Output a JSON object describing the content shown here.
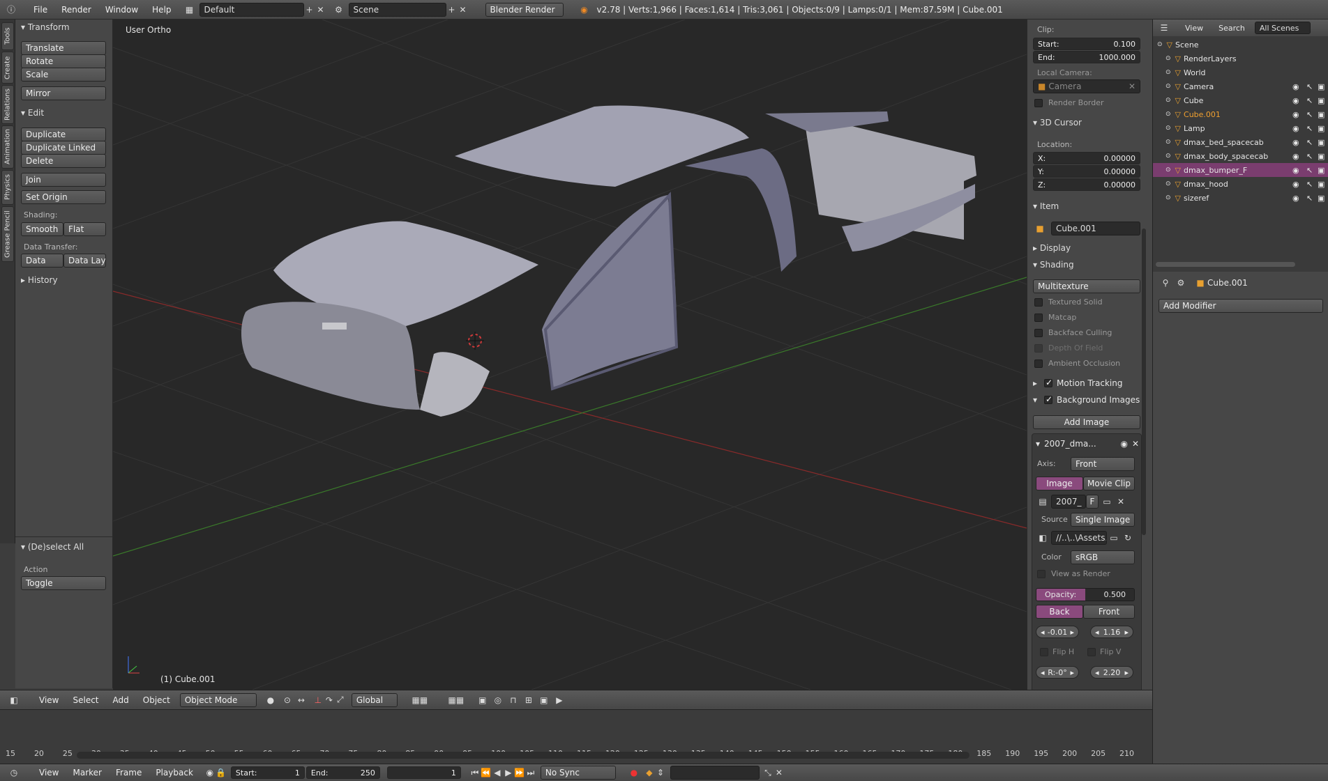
{
  "topbar": {
    "menus": [
      "File",
      "Render",
      "Window",
      "Help"
    ],
    "layout": "Default",
    "scene": "Scene",
    "engine": "Blender Render",
    "stats": "v2.78 | Verts:1,966 | Faces:1,614 | Tris:3,061 | Objects:0/9 | Lamps:0/1 | Mem:87.59M | Cube.001"
  },
  "vertical_tabs": [
    "Tools",
    "Create",
    "Relations",
    "Animation",
    "Physics",
    "Grease Pencil"
  ],
  "tools": {
    "transform_header": "Transform",
    "translate": "Translate",
    "rotate": "Rotate",
    "scale": "Scale",
    "mirror": "Mirror",
    "edit_header": "Edit",
    "duplicate": "Duplicate",
    "duplicate_linked": "Duplicate Linked",
    "delete": "Delete",
    "join": "Join",
    "set_origin": "Set Origin",
    "shading_label": "Shading:",
    "smooth": "Smooth",
    "flat": "Flat",
    "data_transfer_label": "Data Transfer:",
    "data": "Data",
    "data_layout": "Data Layo",
    "history_header": "History",
    "deselect_header": "(De)select All",
    "action_label": "Action",
    "action_value": "Toggle"
  },
  "viewport": {
    "view_name": "User Ortho",
    "object_label": "(1) Cube.001"
  },
  "properties": {
    "clip_label": "Clip:",
    "start_label": "Start:",
    "start_value": "0.100",
    "end_label": "End:",
    "end_value": "1000.000",
    "local_camera_label": "Local Camera:",
    "camera_placeholder": "Camera",
    "render_border": "Render Border",
    "cursor_header": "3D Cursor",
    "location_label": "Location:",
    "x_label": "X:",
    "x_value": "0.00000",
    "y_label": "Y:",
    "y_value": "0.00000",
    "z_label": "Z:",
    "z_value": "0.00000",
    "item_header": "Item",
    "item_name": "Cube.001",
    "display_header": "Display",
    "shading_header": "Shading",
    "shading_mode": "Multitexture",
    "textured_solid": "Textured Solid",
    "matcap": "Matcap",
    "backface_culling": "Backface Culling",
    "depth_of_field": "Depth Of Field",
    "ambient_occlusion": "Ambient Occlusion",
    "motion_tracking": "Motion Tracking",
    "background_images": "Background Images",
    "add_image": "Add Image",
    "bg_image_name": "2007_dma...",
    "axis_label": "Axis:",
    "axis_value": "Front",
    "tab_image": "Image",
    "tab_movie_clip": "Movie Clip",
    "image_field": "2007_",
    "image_f": "F",
    "source_label": "Source",
    "source_value": "Single Image",
    "path_value": "//..\\..\\Assets...",
    "color_label": "Color",
    "color_value": "sRGB",
    "view_as_render": "View as Render",
    "opacity_label": "Opacity:",
    "opacity_value": "0.500",
    "opacity_fraction": 0.5,
    "back": "Back",
    "front": "Front",
    "offset_x": "-0.01",
    "offset_y": "1.16",
    "flip_h": "Flip H",
    "flip_v": "Flip V",
    "rotation": "R:-0°",
    "size": "2.20"
  },
  "outliner": {
    "view": "View",
    "search": "Search",
    "filter": "All Scenes",
    "rows": [
      {
        "label": "Scene",
        "color": "#e6e6e6",
        "selected": false
      },
      {
        "label": "RenderLayers",
        "color": "#e6e6e6",
        "selected": false
      },
      {
        "label": "World",
        "color": "#e6e6e6",
        "selected": false
      },
      {
        "label": "Camera",
        "color": "#e6e6e6",
        "selected": false
      },
      {
        "label": "Cube",
        "color": "#e6e6e6",
        "selected": false
      },
      {
        "label": "Cube.001",
        "color": "#f0a030",
        "selected": false
      },
      {
        "label": "Lamp",
        "color": "#e6e6e6",
        "selected": false
      },
      {
        "label": "dmax_bed_spacecab",
        "color": "#e6e6e6",
        "selected": false
      },
      {
        "label": "dmax_body_spacecab",
        "color": "#e6e6e6",
        "selected": false
      },
      {
        "label": "dmax_bumper_F",
        "color": "#e6e6e6",
        "selected": true
      },
      {
        "label": "dmax_hood",
        "color": "#e6e6e6",
        "selected": false
      },
      {
        "label": "sizeref",
        "color": "#e6e6e6",
        "selected": false
      }
    ]
  },
  "modifiers": {
    "object": "Cube.001",
    "add_modifier": "Add Modifier"
  },
  "view_header": {
    "view": "View",
    "select": "Select",
    "add": "Add",
    "object": "Object",
    "mode": "Object Mode",
    "orientation": "Global"
  },
  "timeline": {
    "ticks": [
      "15",
      "20",
      "25",
      "30",
      "35",
      "40",
      "45",
      "50",
      "55",
      "60",
      "65",
      "70",
      "75",
      "80",
      "85",
      "90",
      "95",
      "100",
      "105",
      "110",
      "115",
      "120",
      "125",
      "130",
      "135",
      "140",
      "145",
      "150",
      "155",
      "160",
      "165",
      "170",
      "175",
      "180",
      "185",
      "190",
      "195",
      "200",
      "205",
      "210"
    ]
  },
  "timeline_header": {
    "view": "View",
    "marker": "Marker",
    "frame": "Frame",
    "playback": "Playback",
    "start_label": "Start:",
    "start_value": "1",
    "end_label": "End:",
    "end_value": "250",
    "current": "1",
    "sync": "No Sync"
  }
}
